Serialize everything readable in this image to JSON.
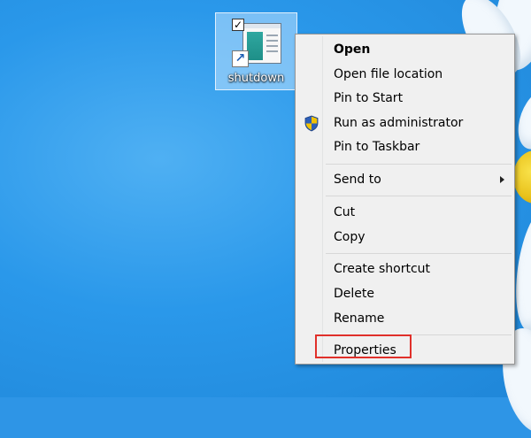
{
  "desktop": {
    "icon": {
      "label": "shutdown",
      "checked": true,
      "icon_name": "shortcut-app-icon"
    }
  },
  "context_menu": {
    "items": [
      {
        "label": "Open",
        "bold": true
      },
      {
        "label": "Open file location"
      },
      {
        "label": "Pin to Start"
      },
      {
        "label": "Run as administrator",
        "icon": "uac-shield-icon"
      },
      {
        "label": "Pin to Taskbar"
      },
      {
        "label": "Send to",
        "submenu": true
      },
      {
        "label": "Cut"
      },
      {
        "label": "Copy"
      },
      {
        "label": "Create shortcut"
      },
      {
        "label": "Delete"
      },
      {
        "label": "Rename"
      },
      {
        "label": "Properties",
        "highlighted": true
      }
    ]
  },
  "colors": {
    "desktop_background": "#2e95e6",
    "menu_background": "#f0f0f0",
    "highlight_outline": "#e0302a"
  }
}
